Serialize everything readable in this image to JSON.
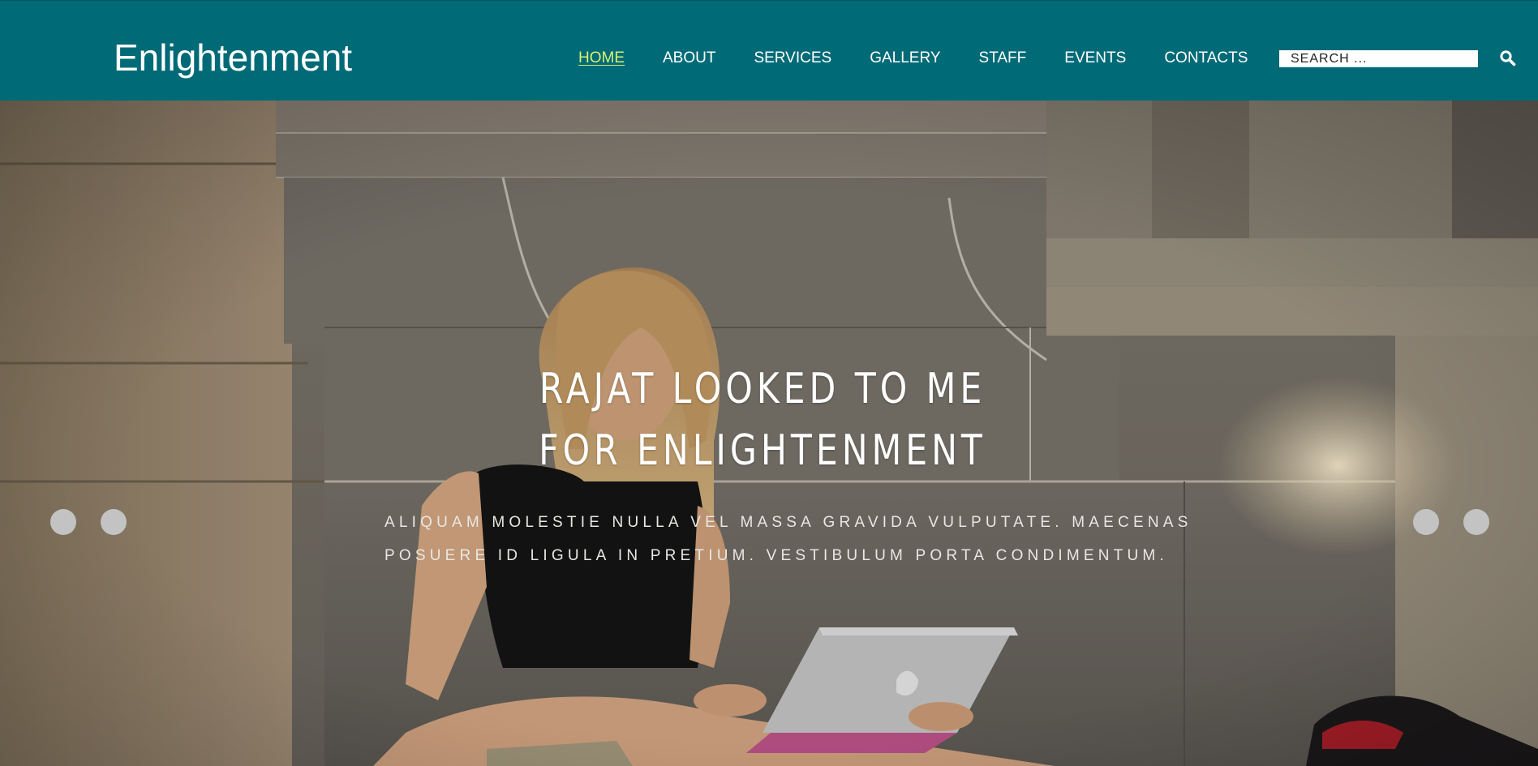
{
  "header": {
    "logo": "Enlightenment",
    "brand_color": "#006a77",
    "active_color": "#d8f074"
  },
  "nav": {
    "items": [
      {
        "label": "HOME",
        "active": true
      },
      {
        "label": "ABOUT",
        "active": false
      },
      {
        "label": "SERVICES",
        "active": false
      },
      {
        "label": "GALLERY",
        "active": false
      },
      {
        "label": "STAFF",
        "active": false
      },
      {
        "label": "EVENTS",
        "active": false
      },
      {
        "label": "CONTACTS",
        "active": false
      }
    ]
  },
  "search": {
    "placeholder": "SEARCH ...",
    "icon": "search-icon"
  },
  "hero": {
    "title": "RAJAT LOOKED TO ME FOR ENLIGHTENMENT",
    "text": "Aliquam molestie nulla vel massa gravida vulputate. Maecenas posuere id ligula in pretium. Vestibulum porta condimentum.",
    "image": "photo of a student sitting on stone steps using a laptop",
    "controls": {
      "left": [
        "slider-dot-1",
        "slider-dot-2"
      ],
      "right": [
        "slider-dot-3",
        "slider-dot-4"
      ]
    }
  }
}
